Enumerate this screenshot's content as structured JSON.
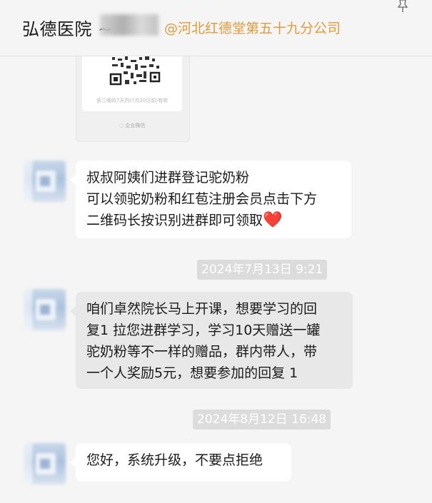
{
  "header": {
    "title": "弘德医院 ~",
    "org_label": "@河北红德堂第五十九分公司"
  },
  "qr_card": {
    "caption": "该二维码7天内(7月20日前)有效",
    "footer": "企业微信"
  },
  "messages": [
    {
      "lines": [
        "叔叔阿姨们进群登记驼奶粉",
        "可以领驼奶粉和红苞注册会员点击下方",
        "二维码长按识别进群即可领取"
      ],
      "emoji": "❤️"
    },
    {
      "lines": [
        "咱们卓然院长马上开课，想要学习的回",
        "复1 拉您进群学习，学习10天赠送一罐",
        "驼奶粉等不一样的赠品，群内带人，带",
        "一个人奖励5元，想要参加的回复 1"
      ]
    },
    {
      "lines": [
        "您好，系统升级，不要点拒绝"
      ]
    }
  ],
  "timestamps": [
    "2024年7月13日 9:21",
    "2024年8月12日 16:48"
  ]
}
